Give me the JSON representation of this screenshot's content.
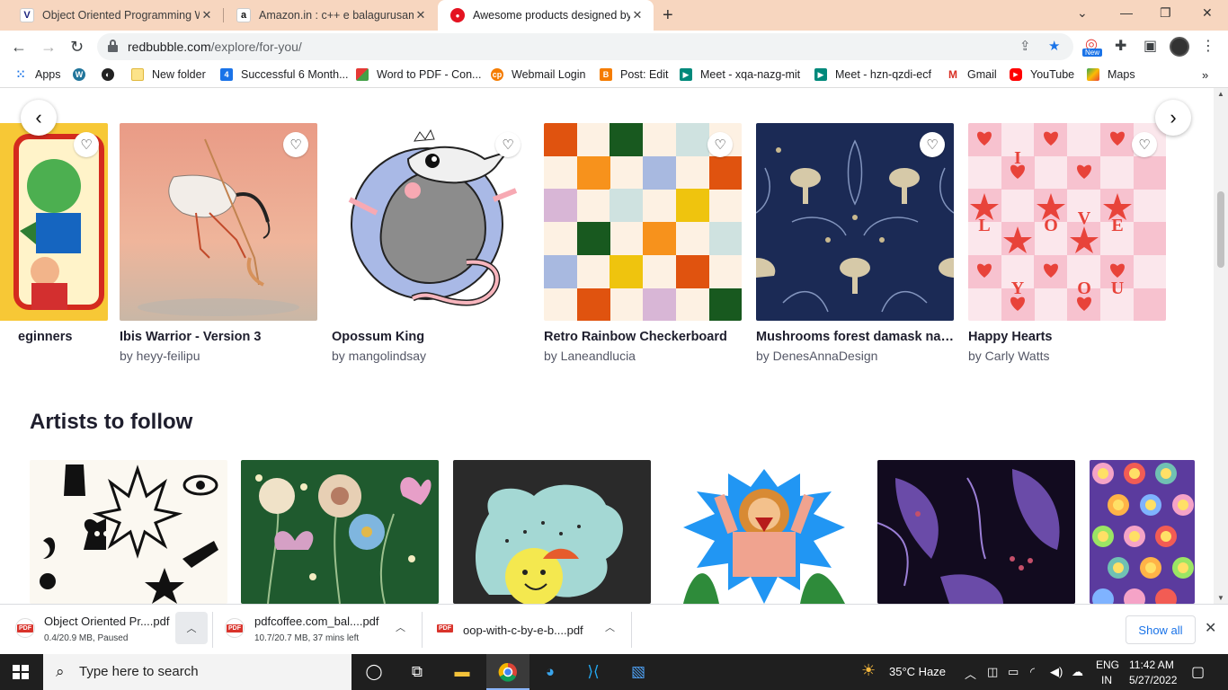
{
  "tabs": [
    {
      "title": "Object Oriented Programming W",
      "favicon": "V"
    },
    {
      "title": "Amazon.in : c++ e balagurusamy",
      "favicon": "a"
    },
    {
      "title": "Awesome products designed by",
      "favicon": "rb",
      "active": true
    }
  ],
  "address": {
    "domain": "redbubble.com",
    "path": "/explore/for-you/"
  },
  "profile_badge": "New",
  "bookmarks": [
    {
      "label": "Apps",
      "icon": "apps-grid-icon"
    },
    {
      "label": "",
      "icon": "wordpress-icon"
    },
    {
      "label": "",
      "icon": "globe-icon"
    },
    {
      "label": "New folder",
      "icon": "folder-icon"
    },
    {
      "label": "Successful 6 Month...",
      "icon": "bookmark-4-icon"
    },
    {
      "label": "Word to PDF - Con...",
      "icon": "word-to-pdf-icon"
    },
    {
      "label": "Webmail Login",
      "icon": "webmail-icon"
    },
    {
      "label": "Post: Edit",
      "icon": "blogger-icon"
    },
    {
      "label": "Meet - xqa-nazg-mit",
      "icon": "meet-icon"
    },
    {
      "label": "Meet - hzn-qzdi-ecf",
      "icon": "meet-icon"
    },
    {
      "label": "Gmail",
      "icon": "gmail-icon"
    },
    {
      "label": "YouTube",
      "icon": "youtube-icon"
    },
    {
      "label": "Maps",
      "icon": "maps-icon"
    }
  ],
  "products": [
    {
      "title": "eginners",
      "artist": ""
    },
    {
      "title": "Ibis Warrior - Version 3",
      "artist": "by heyy-feilipu"
    },
    {
      "title": "Opossum King",
      "artist": "by mangolindsay"
    },
    {
      "title": "Retro Rainbow Checkerboard",
      "artist": "by Laneandlucia"
    },
    {
      "title": "Mushrooms forest damask nav...",
      "artist": "by DenesAnnaDesign"
    },
    {
      "title": "Happy Hearts",
      "artist": "by Carly Watts"
    }
  ],
  "happy_hearts_letters": [
    "I",
    "L",
    "O",
    "V",
    "E",
    "Y",
    "O",
    "U"
  ],
  "section_title": "Artists to follow",
  "downloads": [
    {
      "name": "Object Oriented Pr....pdf",
      "status": "0.4/20.9 MB, Paused"
    },
    {
      "name": "pdfcoffee.com_bal....pdf",
      "status": "10.7/20.7 MB, 37 mins left"
    },
    {
      "name": "oop-with-c-by-e-b....pdf",
      "status": ""
    }
  ],
  "show_all": "Show all",
  "taskbar": {
    "search_placeholder": "Type here to search",
    "weather": "35°C  Haze",
    "lang1": "ENG",
    "lang2": "IN",
    "time": "11:42 AM",
    "date": "5/27/2022"
  },
  "colors": {
    "tabbar": "#f7d6bf",
    "accent": "#1a73e8",
    "taskbar": "#1f1f1f"
  }
}
